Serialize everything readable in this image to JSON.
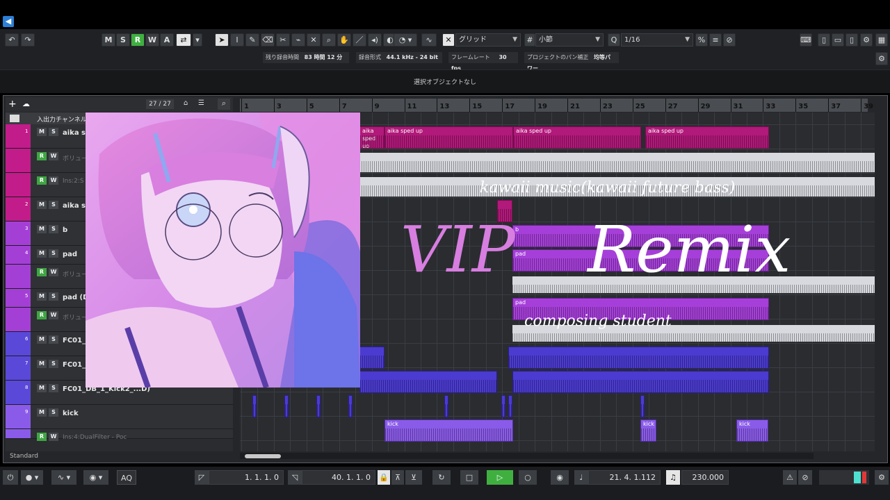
{
  "toolbar": {
    "modes": [
      "M",
      "S",
      "R",
      "W",
      "A"
    ],
    "active_mode": "R",
    "grid_type": "グリッド",
    "grid_unit": "小節",
    "quantize": "1/16"
  },
  "infobar": {
    "rec_time_label": "残り録音時間",
    "rec_time_value": "83 時間 12 分",
    "rec_format_label": "録音形式",
    "rec_format_value": "44.1 kHz - 24 bit",
    "frame_rate_label": "フレームレート",
    "frame_rate_value": "30 fps",
    "pan_label": "プロジェクトのパン補正",
    "pan_value": "均等パワー"
  },
  "selection_status": "選択オブジェクトなし",
  "tracklist": {
    "count": "27 / 27",
    "header": "入出力チャンネル",
    "status": "Standard",
    "tracks": [
      {
        "num": "1",
        "name": "aika sp",
        "color": "#c21c8a"
      },
      {
        "num": "",
        "name": "ボリュー",
        "color": "#c21c8a"
      },
      {
        "num": "",
        "name": "Ins:2:S",
        "color": "#c21c8a"
      },
      {
        "num": "2",
        "name": "aika sp",
        "color": "#c21c8a"
      },
      {
        "num": "3",
        "name": "b",
        "color": "#a43fd6"
      },
      {
        "num": "4",
        "name": "pad",
        "color": "#a43fd6"
      },
      {
        "num": "",
        "name": "ボリュー",
        "color": "#a43fd6"
      },
      {
        "num": "5",
        "name": "pad (D",
        "color": "#a43fd6"
      },
      {
        "num": "",
        "name": "ボリュー",
        "color": "#a43fd6"
      },
      {
        "num": "6",
        "name": "FC01_",
        "color": "#5a48d8"
      },
      {
        "num": "7",
        "name": "FC01_",
        "color": "#5a48d8"
      },
      {
        "num": "8",
        "name": "FC01_DB_1_Kick2_...D)",
        "color": "#5a48d8"
      },
      {
        "num": "9",
        "name": "kick",
        "color": "#8a5be8"
      },
      {
        "num": "",
        "name": "Ins:4:DualFilter - Poc",
        "color": "#8a5be8"
      }
    ]
  },
  "ruler": [
    "1",
    "3",
    "5",
    "7",
    "9",
    "11",
    "13",
    "15",
    "17",
    "19",
    "21",
    "23",
    "25",
    "27",
    "29",
    "31",
    "33",
    "35",
    "37",
    "39"
  ],
  "events": {
    "vocal": "aika sped up",
    "bass": "b",
    "pad": "pad",
    "kick": "kick"
  },
  "overlay": {
    "subtitle": "kawaii music(kawaii future bass)",
    "title_left": "VIP",
    "title_right": "Remix",
    "credit": "composing student"
  },
  "transport": {
    "left_locator": "1. 1. 1.   0",
    "right_locator": "40. 1. 1.   0",
    "position": "21. 4. 1.112",
    "tempo": "230.000",
    "aq_label": "AQ"
  }
}
